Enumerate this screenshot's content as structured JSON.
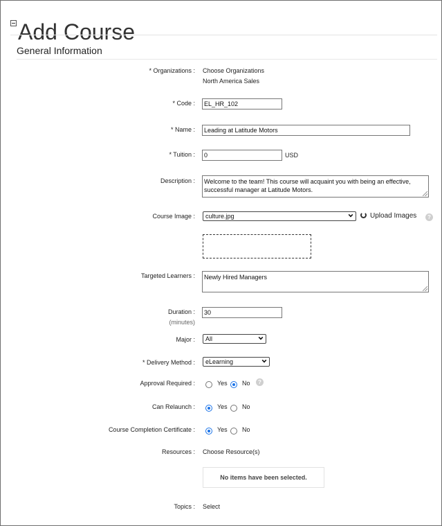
{
  "page": {
    "title": "Add Course",
    "section_title": "General Information"
  },
  "form": {
    "organizations": {
      "label": "* Organizations :",
      "action": "Choose Organizations",
      "selected": "North America Sales"
    },
    "code": {
      "label": "* Code :",
      "value": "EL_HR_102"
    },
    "name": {
      "label": "* Name :",
      "value": "Leading at Latitude Motors"
    },
    "tuition": {
      "label": "* Tuition :",
      "value": "0",
      "unit": "USD"
    },
    "description": {
      "label": "Description :",
      "value": "Welcome to the team! This course will acquaint you with being an effective, successful manager at Latitude Motors."
    },
    "course_image": {
      "label": "Course Image :",
      "selected": "culture.jpg",
      "upload_label": "Upload Images"
    },
    "targeted_learners": {
      "label": "Targeted Learners :",
      "value": "Newly Hired Managers"
    },
    "duration": {
      "label": "Duration :",
      "sublabel": "(minutes)",
      "value": "30"
    },
    "major": {
      "label": "Major :",
      "selected": "All"
    },
    "delivery_method": {
      "label": "* Delivery Method :",
      "selected": "eLearning"
    },
    "approval_required": {
      "label": "Approval Required :",
      "yes": "Yes",
      "no": "No",
      "value": "No"
    },
    "can_relaunch": {
      "label": "Can Relaunch :",
      "yes": "Yes",
      "no": "No",
      "value": "Yes"
    },
    "completion_certificate": {
      "label": "Course Completion Certificate :",
      "yes": "Yes",
      "no": "No",
      "value": "Yes"
    },
    "resources": {
      "label": "Resources :",
      "action": "Choose Resource(s)",
      "empty_text": "No items have been selected."
    },
    "topics": {
      "label": "Topics :",
      "action": "Select"
    }
  },
  "icons": {
    "collapse": "collapse-icon",
    "refresh": "refresh-icon",
    "help": "help-icon",
    "dropdown": "chevron-down-icon"
  },
  "colors": {
    "radio_selected": "#1a73e8",
    "border": "#767676"
  }
}
